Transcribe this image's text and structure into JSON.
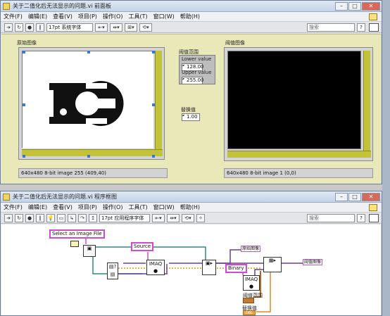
{
  "front_panel": {
    "title": "关于二值化后无法显示的问题.vi 前面板",
    "menu": [
      "文件(F)",
      "编辑(E)",
      "查看(V)",
      "项目(P)",
      "操作(O)",
      "工具(T)",
      "窗口(W)",
      "帮助(H)"
    ],
    "font_selector": "17pt 系统字体",
    "search_placeholder": "搜索",
    "source_label": "原始图像",
    "source_status": "640x480 8-bit image 255     (409,40)",
    "threshold_label": "阈值范围",
    "lower_label": "Lower value",
    "lower_value": "128.00",
    "upper_label": "Upper value",
    "upper_value": "255.00",
    "replace_label": "替换值",
    "replace_value": "1.00",
    "result_label": "阈值图像",
    "result_status": "640x480 8-bit image 1     (0,0)"
  },
  "block_diagram": {
    "title": "关于二值化后无法显示的问题.vi 程序框图",
    "menu": [
      "文件(F)",
      "编辑(E)",
      "查看(V)",
      "项目(P)",
      "操作(O)",
      "工具(T)",
      "窗口(W)",
      "帮助(H)"
    ],
    "font_selector": "17pt 应用程序字体",
    "search_placeholder": "搜索",
    "select_file_const": "Select an Image File",
    "source_const": "Source",
    "binary_const": "Binary",
    "imaq_label": "IMAQ",
    "source_terminal": "原始图像",
    "result_terminal": "阈值图像",
    "threshold_terminal": "阈值范围",
    "replace_terminal": "替换值",
    "replace_num": "DBL"
  },
  "colors": {
    "panel_bg": "#e8e8b8",
    "scrollbar": "#c3c33a",
    "string_wire": "#d24ad2",
    "image_wire": "#8b5a2b",
    "cluster_wire": "#b5651d"
  }
}
